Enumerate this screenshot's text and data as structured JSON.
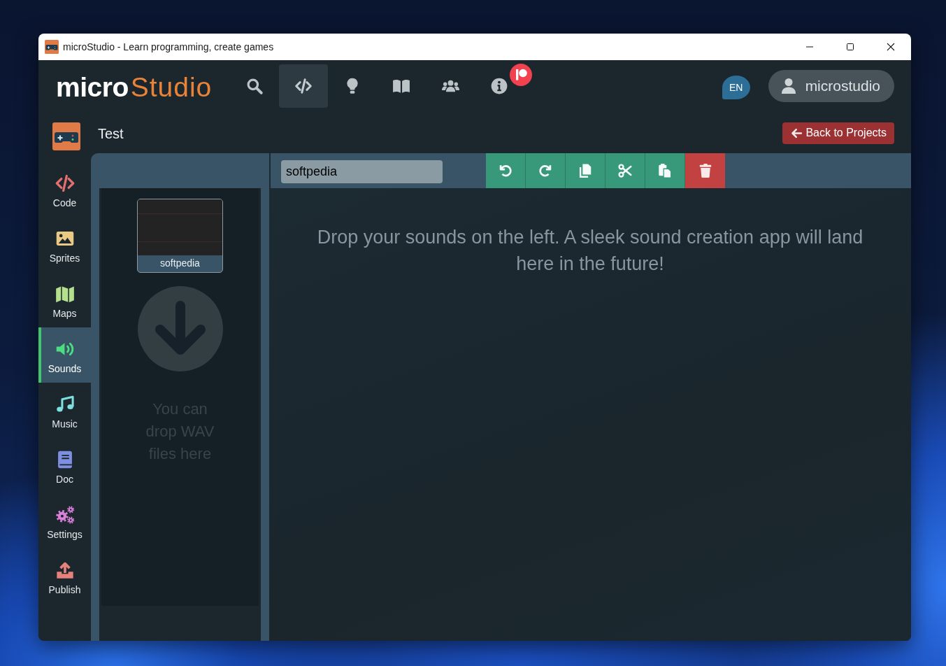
{
  "window": {
    "title": "microStudio - Learn programming, create games"
  },
  "header": {
    "logo": {
      "bold": "micro",
      "light": "Studio"
    },
    "nav": [
      {
        "selected": false
      },
      {
        "selected": true
      },
      {
        "selected": false
      },
      {
        "selected": false
      },
      {
        "selected": false
      },
      {
        "selected": false
      }
    ],
    "language": "EN",
    "user": "microstudio"
  },
  "project": {
    "title": "Test",
    "back_button": "Back to Projects"
  },
  "sidebar": {
    "items": [
      {
        "label": "Code",
        "selected": false
      },
      {
        "label": "Sprites",
        "selected": false
      },
      {
        "label": "Maps",
        "selected": false
      },
      {
        "label": "Sounds",
        "selected": true
      },
      {
        "label": "Music",
        "selected": false
      },
      {
        "label": "Doc",
        "selected": false
      },
      {
        "label": "Settings",
        "selected": false
      },
      {
        "label": "Publish",
        "selected": false
      }
    ]
  },
  "sounds_panel": {
    "sounds": [
      {
        "name": "softpedia"
      }
    ],
    "drop_hint": "You can drop WAV files here"
  },
  "editor": {
    "sound_name": {
      "value": "softpedia"
    },
    "message": "Drop your sounds on the left. A sleek sound creation app will land here in the future!"
  }
}
